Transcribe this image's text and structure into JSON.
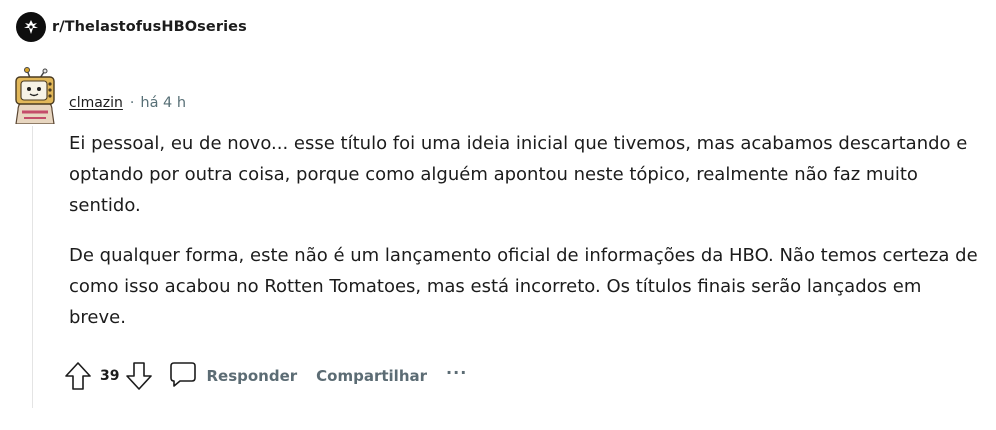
{
  "subreddit": {
    "name": "r/ThelastofusHBOseries",
    "icon": "firefly-logo-icon"
  },
  "comment": {
    "author": "clmazin",
    "separator": "·",
    "timestamp": "há 4 h",
    "avatar_icon": "snoo-avatar-icon",
    "paragraphs": [
      "Ei pessoal, eu de novo... esse título foi uma ideia inicial que tivemos, mas acabamos descartando e optando por outra coisa, porque como alguém apontou neste tópico, realmente não faz muito sentido.",
      "De qualquer forma, este não é um lançamento oficial de informações da HBO. Não temos certeza de como isso acabou no Rotten Tomatoes, mas está incorreto. Os títulos finais serão lançados em breve."
    ]
  },
  "actions": {
    "vote_count": "39",
    "reply_label": "Responder",
    "share_label": "Compartilhar",
    "more_label": "···"
  },
  "colors": {
    "text": "#1c1c1c",
    "muted": "#576f76",
    "action": "#5c6c74",
    "thread_line": "#e4e4e4"
  }
}
